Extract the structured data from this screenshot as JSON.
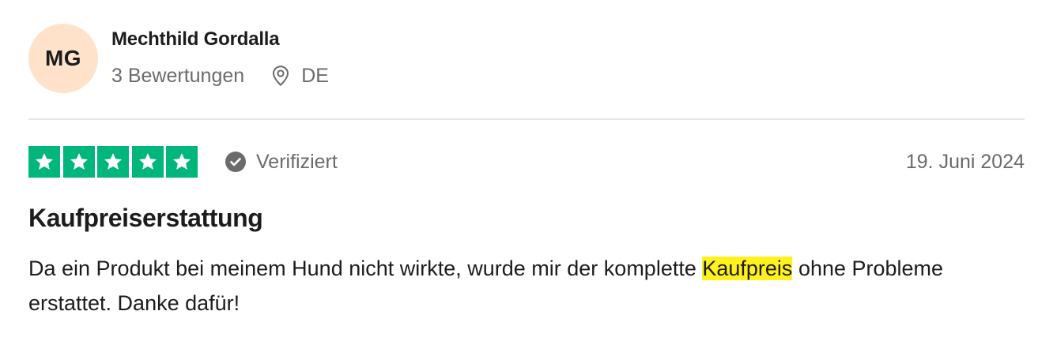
{
  "reviewer": {
    "initials": "MG",
    "name": "Mechthild Gordalla",
    "review_count": "3 Bewertungen",
    "country": "DE",
    "avatar_color": "#ffe2c9"
  },
  "review": {
    "rating": 5,
    "max_rating": 5,
    "star_color": "#00b67a",
    "verified_label": "Verifiziert",
    "date": "19. Juni 2024",
    "title": "Kaufpreiserstattung",
    "body_before": "Da ein Produkt bei meinem Hund nicht wirkte, wurde mir der komplette ",
    "body_highlight": "Kaufpreis",
    "body_after": " ohne Probleme erstattet. Danke dafür!",
    "highlight_color": "#fff11d"
  },
  "icons": {
    "location": "location-pin-icon",
    "verified": "check-circle-icon",
    "star": "star-icon"
  }
}
